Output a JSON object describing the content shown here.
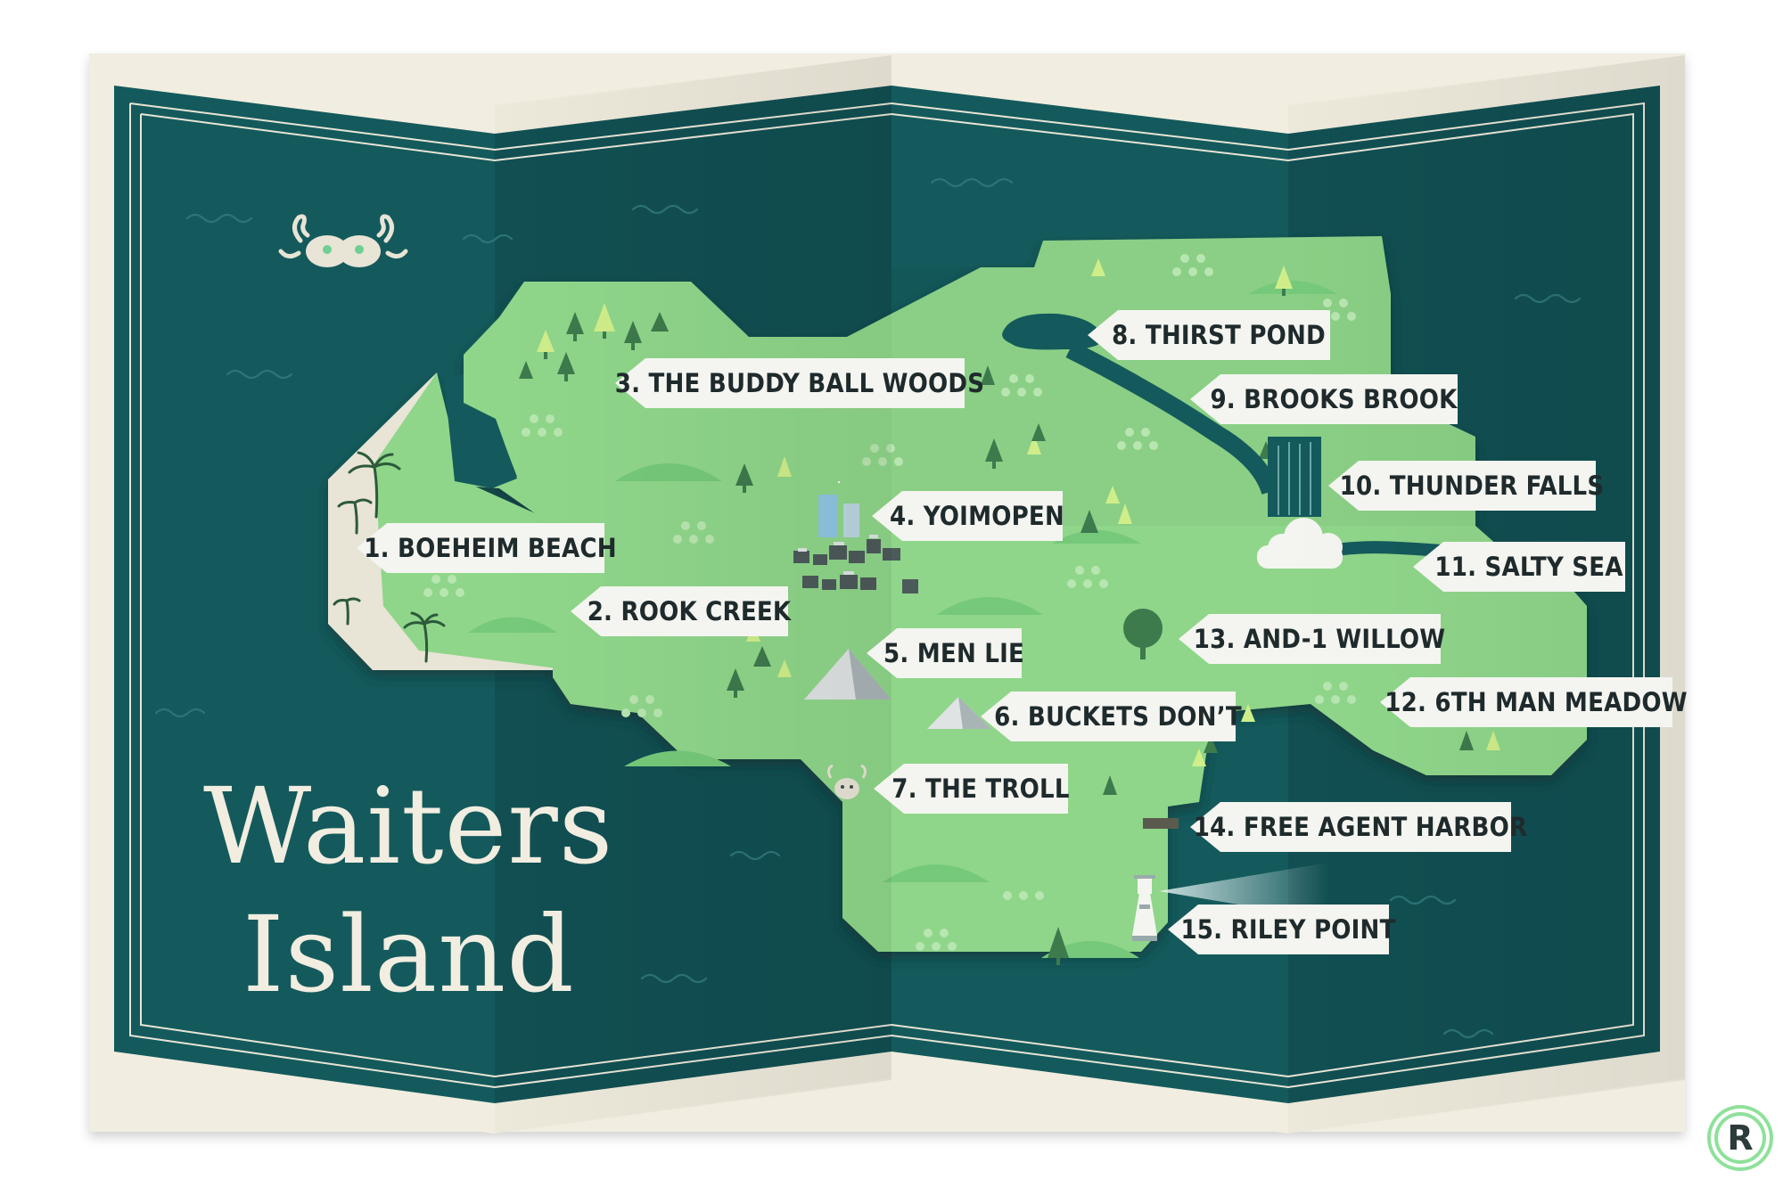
{
  "map": {
    "title_line1": "Waiters",
    "title_line2": "Island",
    "locations": [
      {
        "num": 1,
        "label": "1. BOEHEIM BEACH"
      },
      {
        "num": 2,
        "label": "2. ROOK CREEK"
      },
      {
        "num": 3,
        "label": "3. THE BUDDY BALL WOODS"
      },
      {
        "num": 4,
        "label": "4. YOIMOPEN"
      },
      {
        "num": 5,
        "label": "5. MEN LIE"
      },
      {
        "num": 6,
        "label": "6. BUCKETS DON’T"
      },
      {
        "num": 7,
        "label": "7. THE TROLL"
      },
      {
        "num": 8,
        "label": "8. THIRST POND"
      },
      {
        "num": 9,
        "label": "9. BROOKS BROOK"
      },
      {
        "num": 10,
        "label": "10. THUNDER FALLS"
      },
      {
        "num": 11,
        "label": "11. SALTY SEA"
      },
      {
        "num": 12,
        "label": "12. 6TH MAN MEADOW"
      },
      {
        "num": 13,
        "label": "13. AND-1 WILLOW"
      },
      {
        "num": 14,
        "label": "14. FREE AGENT HARBOR"
      },
      {
        "num": 15,
        "label": "15. RILEY POINT"
      }
    ],
    "logo_letter": "R",
    "colors": {
      "sea": "#145a5c",
      "land": "#8fd68a",
      "land_dark": "#6fbf72",
      "beach": "#e8e4d6",
      "paper": "#f1ede0",
      "tag": "#f4f5f0"
    },
    "icons": [
      "kraken-icon",
      "palm-tree-icon",
      "pine-tree-icon",
      "city-icon",
      "mountain-icon",
      "troll-icon",
      "willow-tree-icon",
      "waterfall-icon",
      "cloud-icon",
      "lighthouse-icon",
      "pier-icon",
      "brand-logo-icon"
    ]
  }
}
